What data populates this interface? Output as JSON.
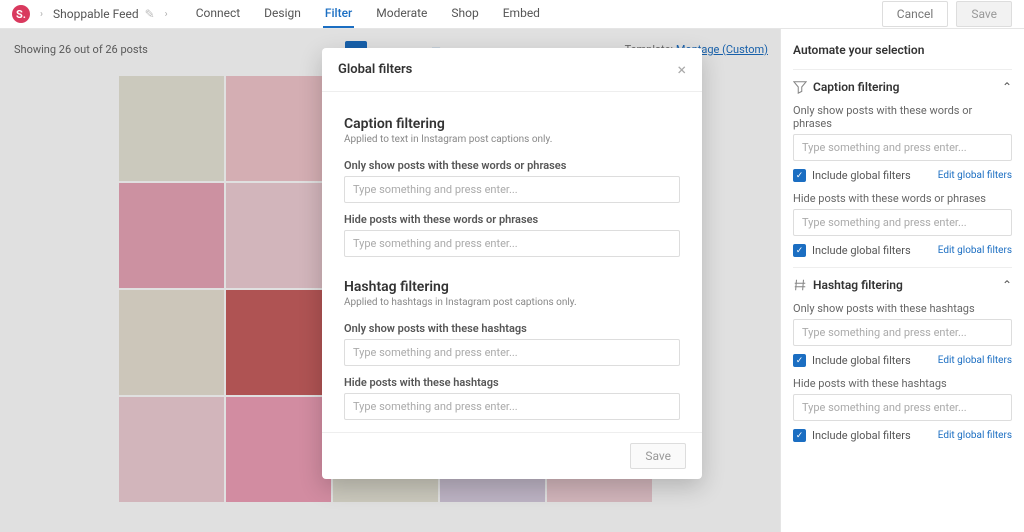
{
  "top": {
    "feed_name": "Shoppable Feed",
    "tabs": [
      "Connect",
      "Design",
      "Filter",
      "Moderate",
      "Shop",
      "Embed"
    ],
    "active_tab": "Filter",
    "cancel": "Cancel",
    "save": "Save"
  },
  "content": {
    "counts": "Showing 26 out of 26 posts",
    "template_label": "Template:",
    "template_value": "Montage (Custom)"
  },
  "modal": {
    "title": "Global filters",
    "caption": {
      "heading": "Caption filtering",
      "sub": "Applied to text in Instagram post captions only.",
      "show_label": "Only show posts with these words or phrases",
      "show_placeholder": "Type something and press enter...",
      "hide_label": "Hide posts with these words or phrases",
      "hide_placeholder": "Type something and press enter..."
    },
    "hashtag": {
      "heading": "Hashtag filtering",
      "sub": "Applied to hashtags in Instagram post captions only.",
      "show_label": "Only show posts with these hashtags",
      "show_placeholder": "Type something and press enter...",
      "hide_label": "Hide posts with these hashtags",
      "hide_placeholder": "Type something and press enter..."
    },
    "save": "Save"
  },
  "sidebar": {
    "title": "Automate your selection",
    "caption": {
      "heading": "Caption filtering",
      "show_label": "Only show posts with these words or phrases",
      "hide_label": "Hide posts with these words or phrases"
    },
    "hashtag": {
      "heading": "Hashtag filtering",
      "show_label": "Only show posts with these hashtags",
      "hide_label": "Hide posts with these hashtags"
    },
    "input_placeholder": "Type something and press enter...",
    "include_label": "Include global filters",
    "edit_link": "Edit global filters"
  }
}
